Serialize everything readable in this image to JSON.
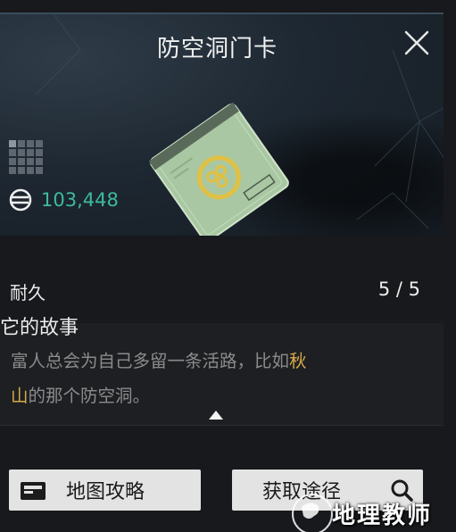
{
  "dialog": {
    "title": "防空洞门卡"
  },
  "item": {
    "price": "103,448",
    "stat_label": "耐久",
    "stat_value": "5 / 5"
  },
  "story": {
    "heading": "它的故事",
    "text_part1": "富人总会为自己多留一条活路，比如",
    "highlight1": "秋",
    "highlight2": "山",
    "text_part2": "的那个防空洞。"
  },
  "buttons": {
    "map_guide": "地图攻略",
    "obtain_method": "获取途径"
  },
  "watermark": {
    "text": "地理教师"
  },
  "colors": {
    "price": "#3dba9f",
    "highlight": "#d6a94a",
    "button_bg": "#e3e3e3"
  },
  "icons": {
    "close": "close-icon",
    "grid": "grid-icon",
    "currency": "currency-icon",
    "map": "map-card-icon",
    "search": "search-icon"
  }
}
